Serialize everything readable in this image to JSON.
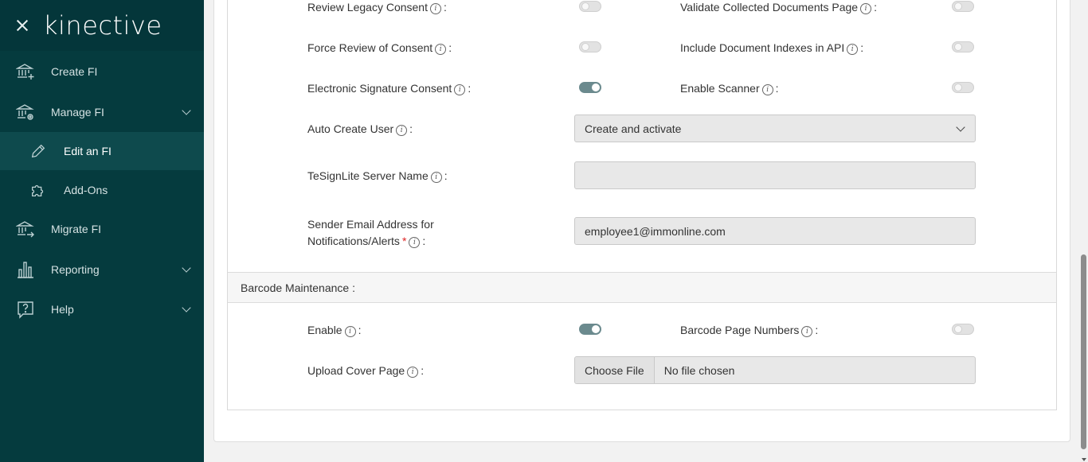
{
  "sidebar": {
    "logo": "kinective",
    "items": [
      {
        "label": "Create FI",
        "icon": "bank-plus-icon"
      },
      {
        "label": "Manage FI",
        "icon": "bank-gear-icon"
      },
      {
        "label": "Edit an FI",
        "icon": "pencil-icon"
      },
      {
        "label": "Add-Ons",
        "icon": "puzzle-icon"
      },
      {
        "label": "Migrate FI",
        "icon": "bank-arrow-icon"
      },
      {
        "label": "Reporting",
        "icon": "bar-chart-icon"
      },
      {
        "label": "Help",
        "icon": "help-bubble-icon"
      }
    ]
  },
  "settings": {
    "review_legacy_consent": {
      "label": "Review Legacy Consent",
      "on": false
    },
    "validate_collected_docs": {
      "label": "Validate Collected Documents Page",
      "on": false
    },
    "force_review_consent": {
      "label": "Force Review of Consent",
      "on": false
    },
    "include_doc_indexes": {
      "label": "Include Document Indexes in API",
      "on": false
    },
    "esign_consent": {
      "label": "Electronic Signature Consent",
      "on": true
    },
    "enable_scanner": {
      "label": "Enable Scanner",
      "on": false
    },
    "auto_create_user": {
      "label": "Auto Create User",
      "value": "Create and activate"
    },
    "tesignlite_server": {
      "label": "TeSignLite Server Name",
      "value": ""
    },
    "sender_email": {
      "label_line1": "Sender Email Address for",
      "label_line2": "Notifications/Alerts",
      "value": "employee1@immonline.com"
    }
  },
  "barcode": {
    "section_title": "Barcode Maintenance :",
    "enable": {
      "label": "Enable",
      "on": true
    },
    "page_numbers": {
      "label": "Barcode Page Numbers",
      "on": false
    },
    "upload_cover": {
      "label": "Upload Cover Page",
      "button": "Choose File",
      "status": "No file chosen"
    }
  },
  "common": {
    "info": "i",
    "colon": ":",
    "required": "*"
  },
  "colors": {
    "sidebar_bg": "#053b3e",
    "toggle_on": "#6b8a8e",
    "field_bg": "#e8e8e8"
  }
}
